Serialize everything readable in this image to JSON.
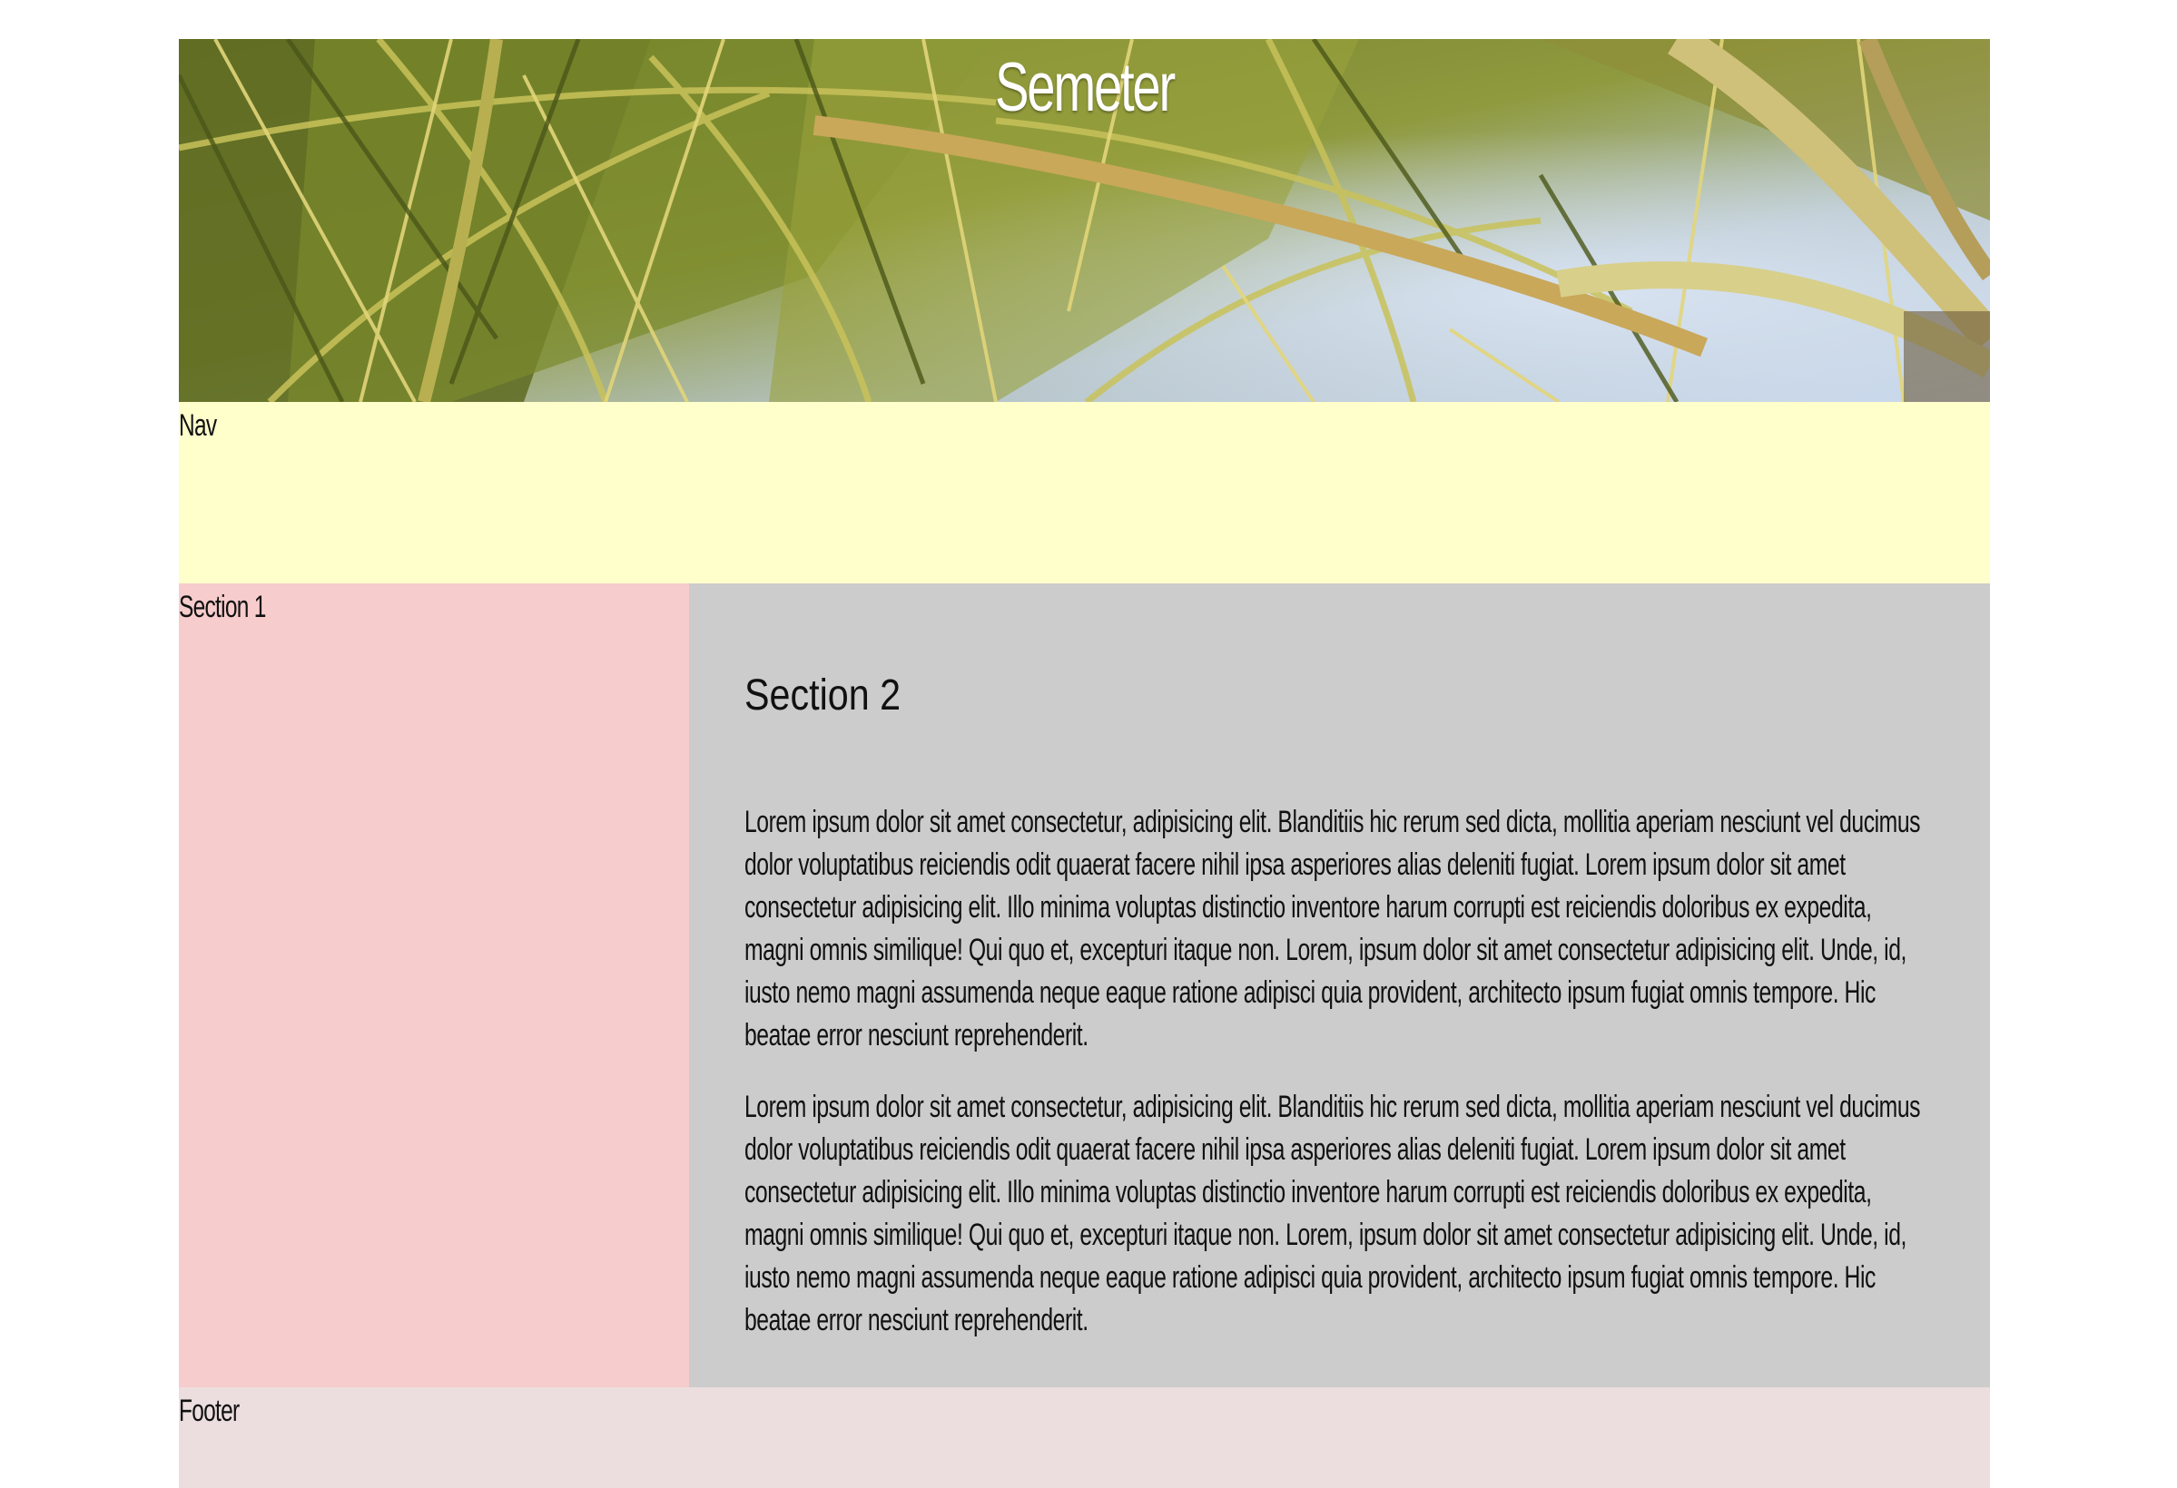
{
  "header": {
    "title": "Semeter"
  },
  "nav": {
    "label": "Nav"
  },
  "section1": {
    "label": "Section 1"
  },
  "section2": {
    "heading": "Section 2",
    "paragraphs": [
      "Lorem ipsum dolor sit amet consectetur, adipisicing elit. Blanditiis hic rerum sed dicta, mollitia aperiam nesciunt vel ducimus dolor voluptatibus reiciendis odit quaerat facere nihil ipsa asperiores alias deleniti fugiat. Lorem ipsum dolor sit amet consectetur adipisicing elit. Illo minima voluptas distinctio inventore harum corrupti est reiciendis doloribus ex expedita, magni omnis similique! Qui quo et, excepturi itaque non. Lorem, ipsum dolor sit amet consectetur adipisicing elit. Unde, id, iusto nemo magni assumenda neque eaque ratione adipisci quia provident, architecto ipsum fugiat omnis tempore. Hic beatae error nesciunt reprehenderit.",
      "Lorem ipsum dolor sit amet consectetur, adipisicing elit. Blanditiis hic rerum sed dicta, mollitia aperiam nesciunt vel ducimus dolor voluptatibus reiciendis odit quaerat facere nihil ipsa asperiores alias deleniti fugiat. Lorem ipsum dolor sit amet consectetur adipisicing elit. Illo minima voluptas distinctio inventore harum corrupti est reiciendis doloribus ex expedita, magni omnis similique! Qui quo et, excepturi itaque non. Lorem, ipsum dolor sit amet consectetur adipisicing elit. Unde, id, iusto nemo magni assumenda neque eaque ratione adipisci quia provident, architecto ipsum fugiat omnis tempore. Hic beatae error nesciunt reprehenderit."
    ]
  },
  "footer": {
    "label": "Footer"
  },
  "colors": {
    "nav_bg": "#ffffcc",
    "section1_bg": "#f7cccc",
    "section2_bg": "#cccccc",
    "footer_bg": "#ecdede",
    "title_color": "#ffffff"
  },
  "header_image": {
    "subject": "palm-fronds-photo"
  }
}
